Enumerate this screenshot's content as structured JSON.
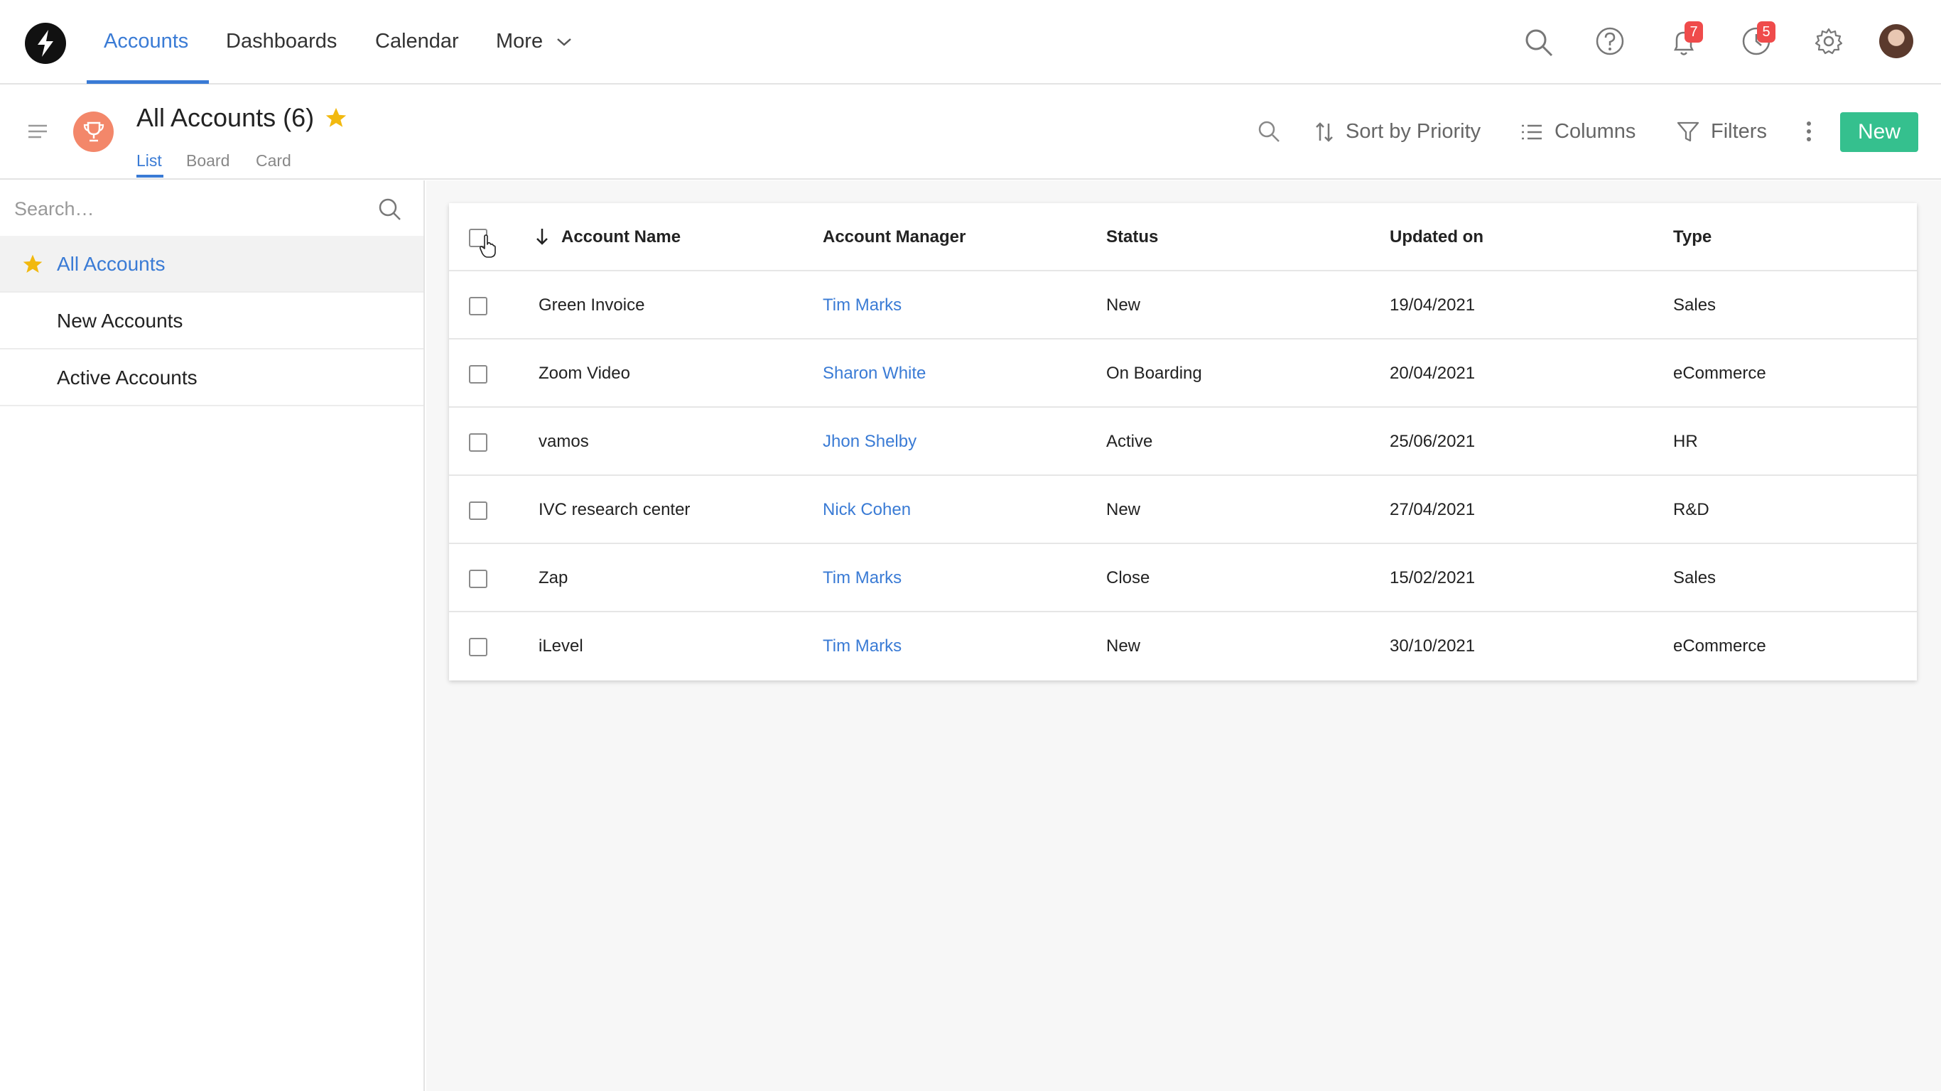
{
  "topnav": {
    "logo_icon": "brand-logo-icon",
    "links": [
      {
        "label": "Accounts",
        "active": true
      },
      {
        "label": "Dashboards",
        "active": false
      },
      {
        "label": "Calendar",
        "active": false
      },
      {
        "label": "More",
        "active": false
      }
    ],
    "notifications_count": "7",
    "activity_count": "5",
    "icons": [
      "search-icon",
      "help-icon",
      "bell-icon",
      "clock-icon",
      "gear-icon",
      "avatar"
    ]
  },
  "subheader": {
    "title": "All Accounts (6)",
    "view_tabs": [
      {
        "label": "List",
        "active": true
      },
      {
        "label": "Board",
        "active": false
      },
      {
        "label": "Card",
        "active": false
      }
    ],
    "sort_label": "Sort by Priority",
    "columns_label": "Columns",
    "filters_label": "Filters",
    "new_label": "New"
  },
  "sidebar": {
    "search_placeholder": "Search…",
    "items": [
      {
        "label": "All Accounts",
        "active": true,
        "starred": true
      },
      {
        "label": "New Accounts",
        "active": false
      },
      {
        "label": "Active Accounts",
        "active": false
      }
    ]
  },
  "table": {
    "columns": [
      "Account Name",
      "Account Manager",
      "Status",
      "Updated on",
      "Type"
    ],
    "sorted_column": "Account Name",
    "rows": [
      {
        "name": "Green Invoice",
        "manager": "Tim Marks",
        "status": "New",
        "updated": "19/04/2021",
        "type": "Sales"
      },
      {
        "name": "Zoom Video",
        "manager": "Sharon White",
        "status": "On Boarding",
        "updated": "20/04/2021",
        "type": "eCommerce"
      },
      {
        "name": "vamos",
        "manager": "Jhon Shelby",
        "status": "Active",
        "updated": "25/06/2021",
        "type": "HR"
      },
      {
        "name": "IVC research center",
        "manager": "Nick Cohen",
        "status": "New",
        "updated": "27/04/2021",
        "type": "R&D"
      },
      {
        "name": "Zap",
        "manager": "Tim Marks",
        "status": "Close",
        "updated": "15/02/2021",
        "type": "Sales"
      },
      {
        "name": "iLevel",
        "manager": "Tim Marks",
        "status": "New",
        "updated": "30/10/2021",
        "type": "eCommerce"
      }
    ]
  },
  "colors": {
    "accent": "#3a7bd5",
    "new_button": "#35c08e",
    "badge": "#ef4b4b",
    "star": "#f2b90f",
    "trophy_bg": "#f3876a"
  }
}
